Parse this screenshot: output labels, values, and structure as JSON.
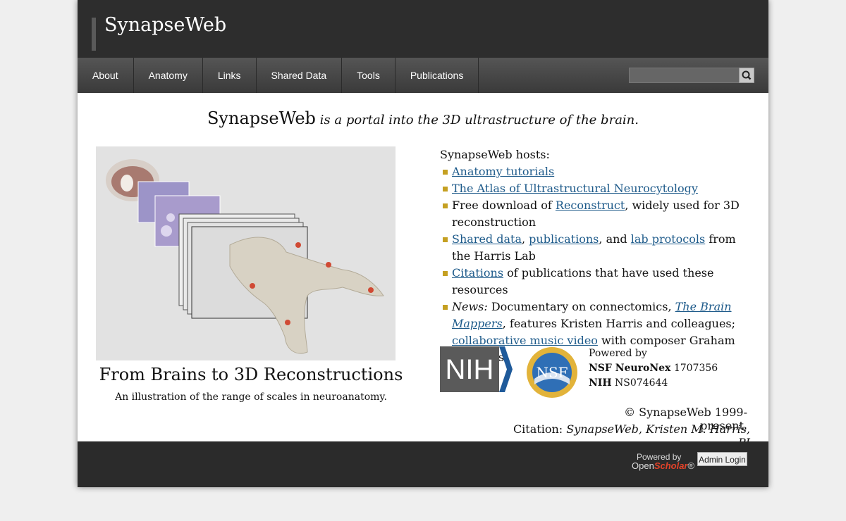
{
  "site": {
    "title": "SynapseWeb"
  },
  "nav": {
    "items": [
      "About",
      "Anatomy",
      "Links",
      "Shared Data",
      "Tools",
      "Publications"
    ]
  },
  "search": {
    "placeholder": ""
  },
  "tagline": {
    "name": "SynapseWeb",
    "rest": " is a portal into the 3D ultrastructure of the brain."
  },
  "figure": {
    "title": "From Brains to 3D Reconstructions",
    "caption": "An illustration of the range of scales in neuroanatomy."
  },
  "hosts": {
    "intro": "SynapseWeb hosts:",
    "item1": "Anatomy tutorials",
    "item2": "The Atlas of Ultrastructural Neurocytology",
    "item3_pre": "Free download of ",
    "item3_link": "Reconstruct",
    "item3_post": ", widely used for 3D reconstruction",
    "item4_link1": "Shared data",
    "item4_sep1": ", ",
    "item4_link2": "publications",
    "item4_sep2": ", and ",
    "item4_link3": "lab protocols",
    "item4_post": " from the Harris Lab",
    "item5_link": "Citations",
    "item5_post": " of publications that have used these resources",
    "item6_news": "News:",
    "item6_pre": " Documentary on connectomics, ",
    "item6_link1": "The Brain Mappers",
    "item6_mid": ", features Kristen Harris and colleagues; ",
    "item6_link2": "collaborative music video",
    "item6_post": " with composer Graham Reynolds"
  },
  "logos": {
    "nih_text": "NIH",
    "nsf_text": "NSF",
    "powered_by": "Powered by",
    "grant1_name": "NSF NeuroNex",
    "grant1_num": " 1707356",
    "grant2_name": "NIH",
    "grant2_num": " NS074644"
  },
  "copyright": "© SynapseWeb 1999-present.",
  "citation": {
    "label": "Citation: ",
    "value": "SynapseWeb, Kristen M. Harris, PI"
  },
  "footer": {
    "powered_by": "Powered by",
    "open": "Open",
    "scholar": "Scholar",
    "reg": "®",
    "admin_login": "Admin Login"
  },
  "colors": {
    "header": "#2d2d2d",
    "bullet": "#c5a022",
    "link": "#1d5a8a",
    "footer": "#2b2b2b"
  }
}
